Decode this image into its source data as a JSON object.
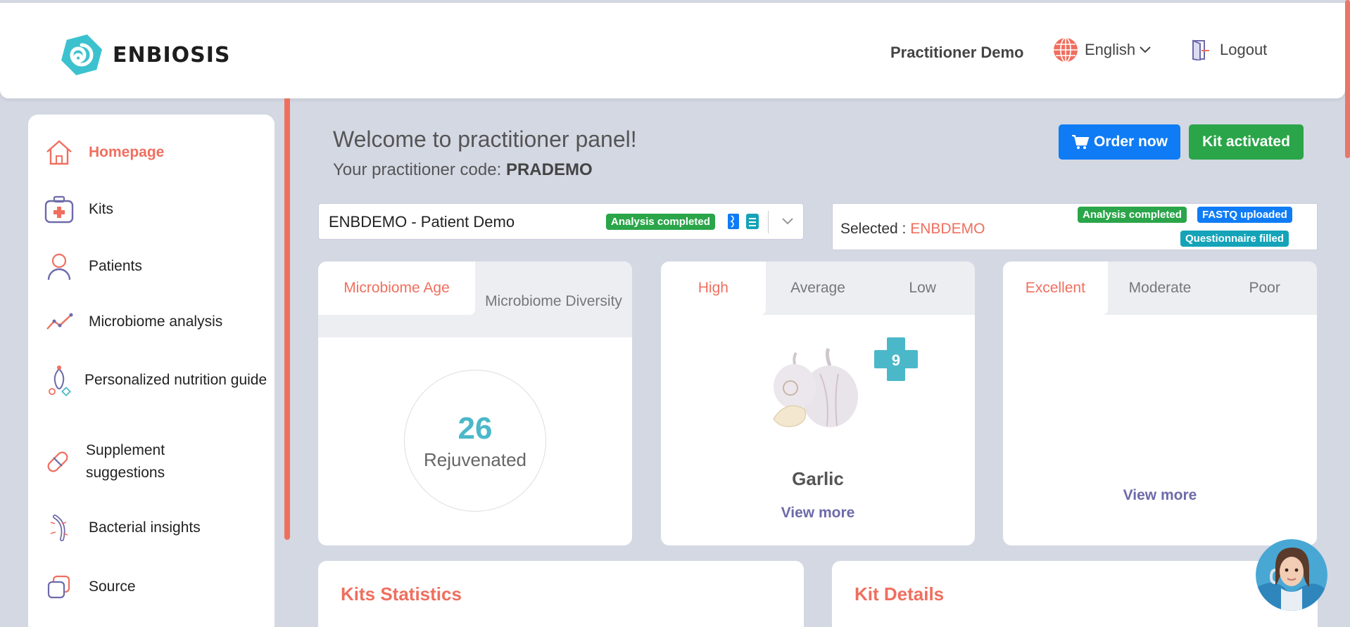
{
  "brand": {
    "name": "ENBIOSIS"
  },
  "header": {
    "user": "Practitioner Demo",
    "language": "English",
    "logout": "Logout"
  },
  "sidebar": {
    "items": [
      {
        "label": "Homepage",
        "icon": "home-icon",
        "active": true
      },
      {
        "label": "Kits",
        "icon": "kit-icon"
      },
      {
        "label": "Patients",
        "icon": "user-icon"
      },
      {
        "label": "Microbiome analysis",
        "icon": "chart-line-icon"
      },
      {
        "label": "Personalized nutrition guide",
        "icon": "nutrition-icon"
      },
      {
        "label": "Supplement suggestions",
        "icon": "pill-icon"
      },
      {
        "label": "Bacterial insights",
        "icon": "bacteria-icon"
      },
      {
        "label": "Source",
        "icon": "source-icon"
      }
    ]
  },
  "main": {
    "welcome": "Welcome to practitioner panel!",
    "code_label": "Your practitioner code: ",
    "code_value": "PRADEMO",
    "order_button": "Order now",
    "kit_button": "Kit activated",
    "patient_select": {
      "value": "ENBDEMO - Patient Demo",
      "badge": "Analysis completed"
    },
    "selected": {
      "label": "Selected : ",
      "value": "ENBDEMO",
      "badges": [
        "Analysis completed",
        "FASTQ uploaded",
        "Questionnaire filled"
      ]
    }
  },
  "cards": {
    "microbiome": {
      "tabs": [
        "Microbiome Age",
        "Microbiome Diversity"
      ],
      "age_value": "26",
      "age_label": "Rejuvenated"
    },
    "foods": {
      "tabs": [
        "High",
        "Average",
        "Low"
      ],
      "score": "9",
      "food_name": "Garlic",
      "view_more": "View more"
    },
    "quality": {
      "tabs": [
        "Excellent",
        "Moderate",
        "Poor"
      ],
      "view_more": "View more"
    }
  },
  "bottom": {
    "kits_statistics": "Kits Statistics",
    "kit_details": "Kit Details"
  },
  "colors": {
    "accent": "#ef6f5f",
    "teal": "#4bb8c9",
    "order_blue": "#0f7cf5",
    "kit_green": "#2aa549",
    "link_purple": "#6d6aa9"
  }
}
